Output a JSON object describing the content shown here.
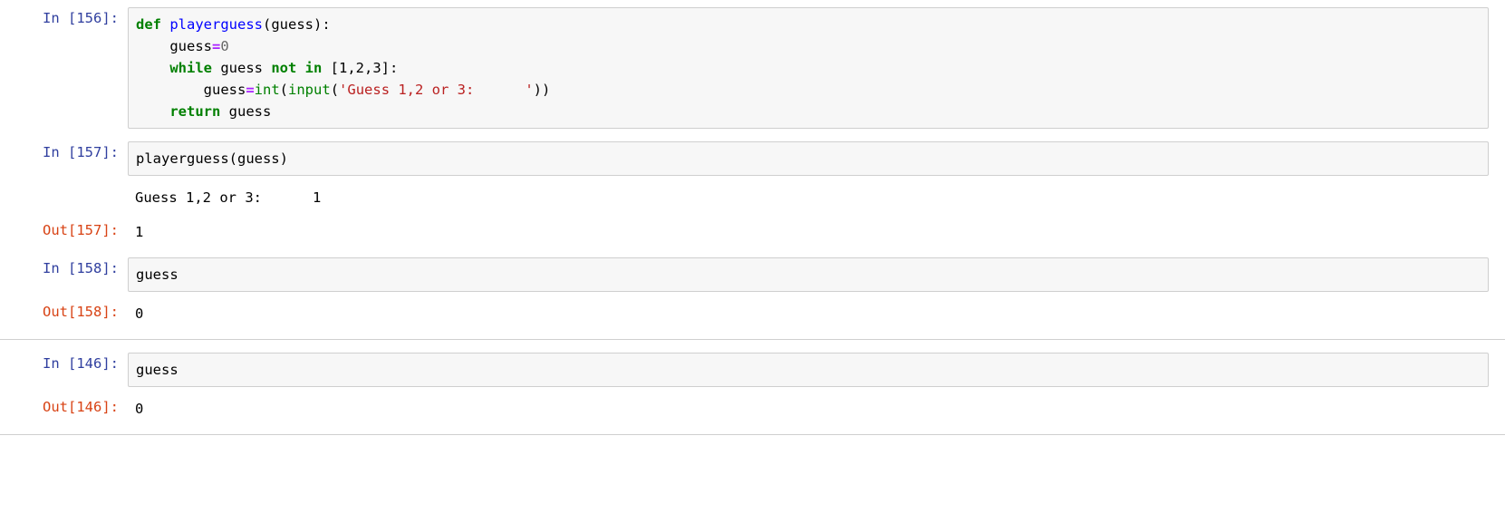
{
  "notebook": {
    "kernel_language": "python",
    "cells": [
      {
        "type": "code",
        "prompt_in": "In [156]:",
        "source_lines": [
          "def playerguess(guess):",
          "    guess=0",
          "    while guess not in [1,2,3]:",
          "        guess=int(input('Guess 1,2 or 3:      '))",
          "    return guess"
        ],
        "tokens": {
          "l1_kw_def": "def",
          "l1_funcname": "playerguess",
          "l1_paren_open": "(",
          "l1_arg": "guess",
          "l1_paren_close": ")",
          "l1_colon": ":",
          "l2_indent": "    ",
          "l2_name": "guess",
          "l2_op": "=",
          "l2_num": "0",
          "l3_indent": "    ",
          "l3_kw_while": "while",
          "l3_name": " guess ",
          "l3_kw_not": "not",
          "l3_sp1": " ",
          "l3_kw_in": "in",
          "l3_list": " [1,2,3]:",
          "l4_indent": "        ",
          "l4_name": "guess",
          "l4_op": "=",
          "l4_builtin_int": "int",
          "l4_paren1": "(",
          "l4_builtin_input": "input",
          "l4_paren2": "(",
          "l4_string": "'Guess 1,2 or 3:      '",
          "l4_parens_close": "))",
          "l5_indent": "    ",
          "l5_kw_return": "return",
          "l5_name": " guess"
        },
        "outputs": []
      },
      {
        "type": "code",
        "prompt_in": "In [157]:",
        "source_lines": [
          "playerguess(guess)"
        ],
        "tokens": {
          "call_text": "playerguess(guess)"
        },
        "outputs": [
          {
            "output_type": "stream",
            "prompt": "",
            "text": "Guess 1,2 or 3:      1"
          },
          {
            "output_type": "execute_result",
            "prompt": "Out[157]:",
            "text": "1"
          }
        ]
      },
      {
        "type": "code",
        "prompt_in": "In [158]:",
        "source_lines": [
          "guess"
        ],
        "tokens": {
          "call_text": "guess"
        },
        "outputs": [
          {
            "output_type": "execute_result",
            "prompt": "Out[158]:",
            "text": "0"
          }
        ]
      },
      {
        "type": "code",
        "prompt_in": "In [146]:",
        "source_lines": [
          "guess"
        ],
        "tokens": {
          "call_text": "guess"
        },
        "outputs": [
          {
            "output_type": "execute_result",
            "prompt": "Out[146]:",
            "text": "0"
          }
        ]
      }
    ]
  },
  "colors": {
    "prompt_in": "#303F9F",
    "prompt_out": "#D84315",
    "keyword": "#008000",
    "function_name": "#0000FF",
    "builtin": "#008000",
    "string": "#BA2121",
    "operator": "#AA22FF",
    "cell_background": "#f7f7f7",
    "cell_border": "#cfcfcf",
    "page_background": "#ffffff",
    "text": "#000000"
  }
}
